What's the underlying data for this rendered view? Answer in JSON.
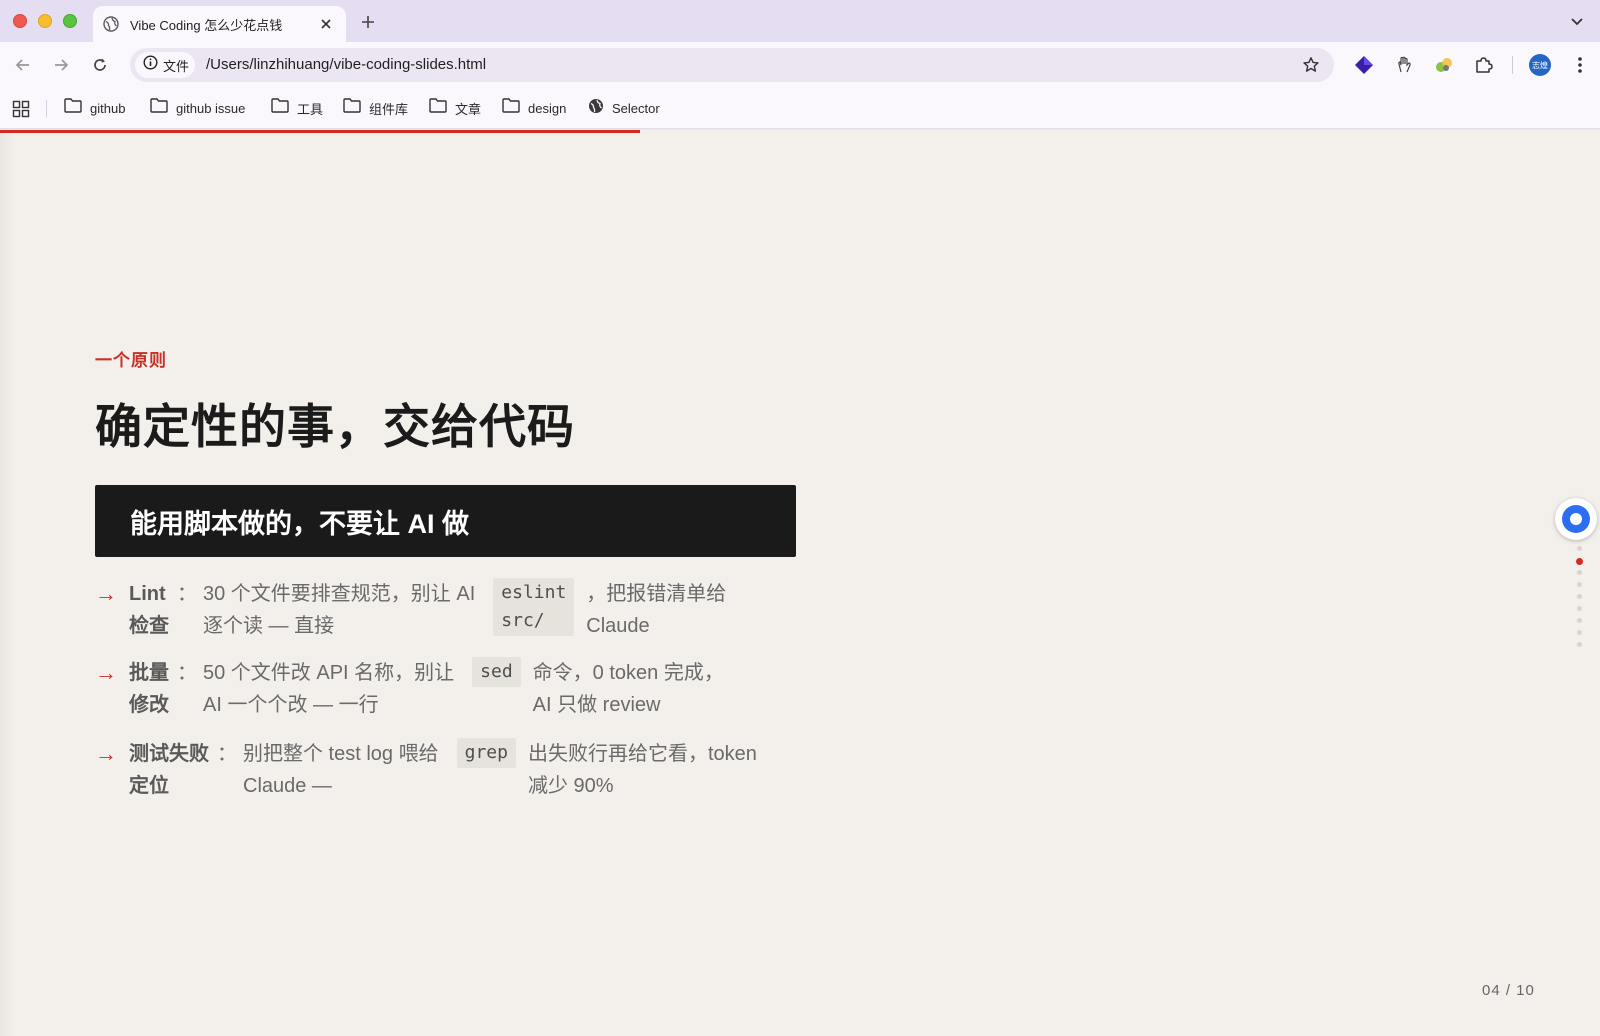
{
  "browser": {
    "tab": {
      "title": "Vibe Coding 怎么少花点钱"
    },
    "site_chip": "文件",
    "url": "/Users/linzhihuang/vibe-coding-slides.html",
    "avatar_text": "志煌",
    "accent_color": "#d42a22"
  },
  "bookmarks": [
    {
      "label": "github"
    },
    {
      "label": "github issue"
    },
    {
      "label": "工具"
    },
    {
      "label": "组件库"
    },
    {
      "label": "文章"
    },
    {
      "label": "design"
    },
    {
      "label": "Selector"
    }
  ],
  "slide": {
    "eyebrow": "一个原则",
    "title": "确定性的事，交给代码",
    "banner": "能用脚本做的，不要让 AI 做",
    "bullets": [
      {
        "label_1": "Lint",
        "label_2": "检查",
        "colon": "：",
        "pre_1": "30 个文件要排查规范，别让 AI",
        "pre_2": "逐个读 — 直接",
        "code_1": "eslint",
        "code_2": "src/",
        "post_1": "，把报错清单给",
        "post_2": "Claude"
      },
      {
        "label_1": "批量",
        "label_2": "修改",
        "colon": "：",
        "pre_1": "50 个文件改 API 名称，别让",
        "pre_2": "AI 一个个改 — 一行",
        "code_1": "sed",
        "post_1": "命令，0 token 完成，",
        "post_2": "AI 只做 review"
      },
      {
        "label_1": "测试失败",
        "label_2": "定位",
        "colon": "：",
        "pre_1": "别把整个 test log 喂给",
        "pre_2": "Claude —",
        "code_1": "grep",
        "post_1": "出失败行再给它看，token",
        "post_2": "减少 90%"
      }
    ],
    "page_indicator": "04 / 10",
    "progress_fraction": 0.4,
    "nav_dots": {
      "count": 9,
      "active_index": 1
    }
  }
}
